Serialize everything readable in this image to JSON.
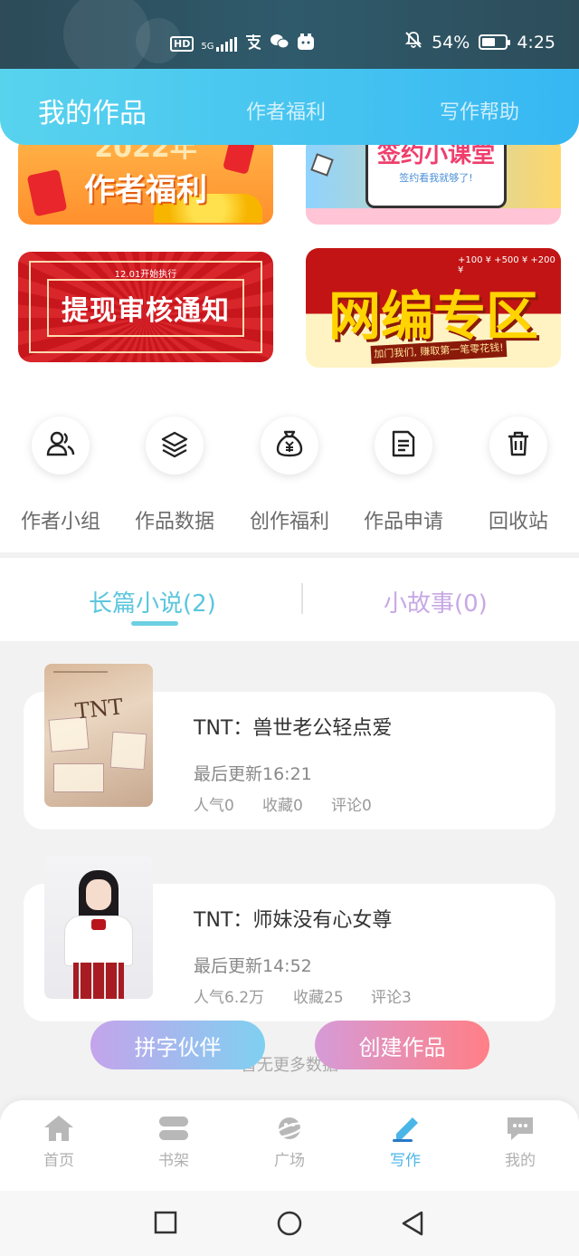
{
  "status_bar": {
    "network_badge": "HD",
    "network_type": "5G",
    "battery_percent": "54%",
    "time": "4:25",
    "icons": [
      "hd-icon",
      "signal-icon",
      "alipay-icon",
      "wechat-icon",
      "app-icon",
      "mute-icon",
      "battery-icon"
    ]
  },
  "header": {
    "tabs": [
      {
        "label": "我的作品",
        "active": true
      },
      {
        "label": "作者福利",
        "active": false
      },
      {
        "label": "写作帮助",
        "active": false
      }
    ]
  },
  "banners": [
    {
      "name": "作者福利",
      "text": "作者福利",
      "partial_text": "2022年"
    },
    {
      "name": "签约小课堂",
      "text": "签约小课堂",
      "subtext": "签约看我就够了!"
    },
    {
      "name": "提现审核通知",
      "text": "提现审核通知",
      "subtext": "12.01开始执行"
    },
    {
      "name": "网编专区",
      "text": "网编专区",
      "subtext": "加门我们, 赚取第一笔零花钱!",
      "money": "+100 ¥  +500 ¥  +200 ¥"
    }
  ],
  "quick_actions": [
    {
      "label": "作者小组",
      "icon": "group-icon"
    },
    {
      "label": "作品数据",
      "icon": "layers-icon"
    },
    {
      "label": "创作福利",
      "icon": "money-bag-icon"
    },
    {
      "label": "作品申请",
      "icon": "document-icon"
    },
    {
      "label": "回收站",
      "icon": "trash-icon"
    }
  ],
  "work_tabs": [
    {
      "label": "长篇小说(2)",
      "active": true
    },
    {
      "label": "小故事(0)",
      "active": false
    }
  ],
  "works": [
    {
      "title": "TNT：兽世老公轻点爱",
      "updated": "最后更新16:21",
      "popularity": "人气0",
      "favorites": "收藏0",
      "comments": "评论0",
      "cover_text": "TNT"
    },
    {
      "title": "TNT：师妹没有心女尊",
      "updated": "最后更新14:52",
      "popularity": "人气6.2万",
      "favorites": "收藏25",
      "comments": "评论3"
    }
  ],
  "no_more_text": "暂无更多数据",
  "floating_buttons": {
    "left": "拼字伙伴",
    "right": "创建作品"
  },
  "bottom_nav": [
    {
      "label": "首页",
      "icon": "home-icon",
      "active": false
    },
    {
      "label": "书架",
      "icon": "bookshelf-icon",
      "active": false
    },
    {
      "label": "广场",
      "icon": "planet-icon",
      "active": false
    },
    {
      "label": "写作",
      "icon": "pen-icon",
      "active": true
    },
    {
      "label": "我的",
      "icon": "chat-bubble-icon",
      "active": false
    }
  ],
  "colors": {
    "accent": "#4ab6e8",
    "header_gradient_start": "#58d3ee",
    "header_gradient_end": "#37b7f2",
    "tab_active": "#5cc6dd",
    "tab_inactive": "#c7a8e6"
  }
}
